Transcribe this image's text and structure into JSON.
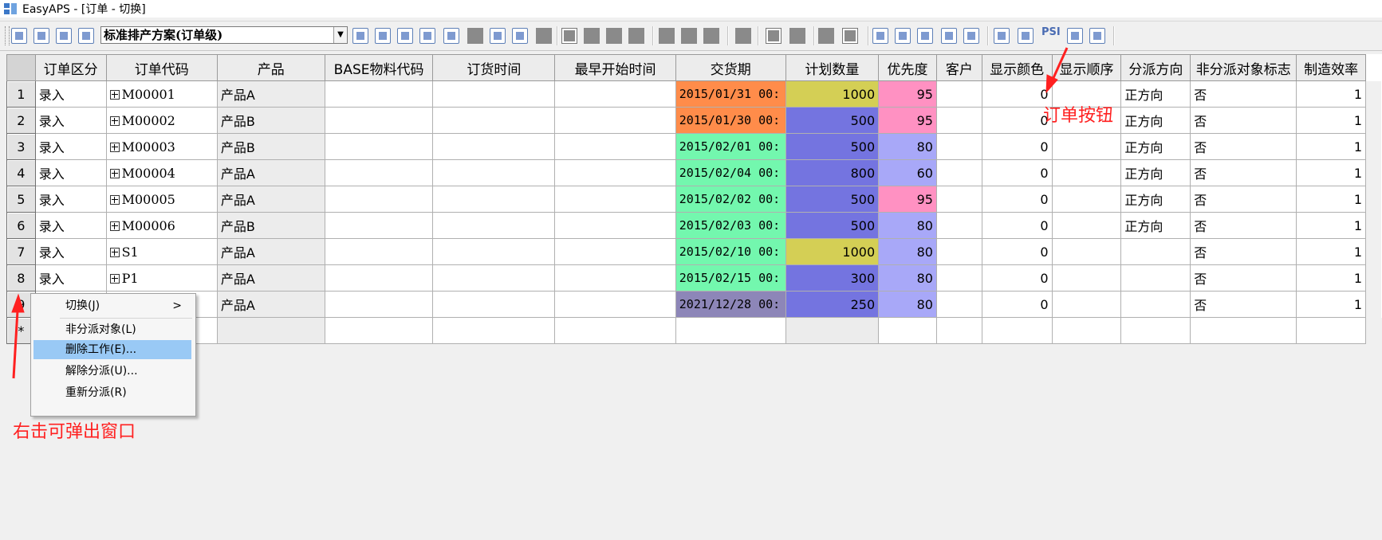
{
  "window": {
    "title": "EasyAPS - [订单 - 切换]"
  },
  "toolbar": {
    "scheme_selected": "标准排产方案(订单级)",
    "psi_label": "PSI"
  },
  "grid": {
    "columns": [
      "订单区分",
      "订单代码",
      "产品",
      "BASE物料代码",
      "订货时间",
      "最早开始时间",
      "交货期",
      "计划数量",
      "优先度",
      "客户",
      "显示颜色",
      "显示顺序",
      "分派方向",
      "非分派对象标志",
      "制造效率"
    ],
    "rows": [
      {
        "n": "1",
        "type": "录入",
        "code": "M00001",
        "product": "产品A",
        "due": "2015/01/31 00:",
        "due_color": "#ff8c4a",
        "qty": "1000",
        "qty_color": "#d4cf55",
        "pri": "95",
        "pri_color": "#ff91c2",
        "color": "0",
        "dir": "正方向",
        "flag": "否",
        "eff": "1"
      },
      {
        "n": "2",
        "type": "录入",
        "code": "M00002",
        "product": "产品B",
        "due": "2015/01/30 00:",
        "due_color": "#ff8c4a",
        "qty": "500",
        "qty_color": "#7474e0",
        "pri": "95",
        "pri_color": "#ff91c2",
        "color": "0",
        "dir": "正方向",
        "flag": "否",
        "eff": "1"
      },
      {
        "n": "3",
        "type": "录入",
        "code": "M00003",
        "product": "产品B",
        "due": "2015/02/01 00:",
        "due_color": "#73f7ae",
        "qty": "500",
        "qty_color": "#7474e0",
        "pri": "80",
        "pri_color": "#a8a8f8",
        "color": "0",
        "dir": "正方向",
        "flag": "否",
        "eff": "1"
      },
      {
        "n": "4",
        "type": "录入",
        "code": "M00004",
        "product": "产品A",
        "due": "2015/02/04 00:",
        "due_color": "#73f7ae",
        "qty": "800",
        "qty_color": "#7474e0",
        "pri": "60",
        "pri_color": "#a8a8f8",
        "color": "0",
        "dir": "正方向",
        "flag": "否",
        "eff": "1"
      },
      {
        "n": "5",
        "type": "录入",
        "code": "M00005",
        "product": "产品A",
        "due": "2015/02/02 00:",
        "due_color": "#73f7ae",
        "qty": "500",
        "qty_color": "#7474e0",
        "pri": "95",
        "pri_color": "#ff91c2",
        "color": "0",
        "dir": "正方向",
        "flag": "否",
        "eff": "1"
      },
      {
        "n": "6",
        "type": "录入",
        "code": "M00006",
        "product": "产品B",
        "due": "2015/02/03 00:",
        "due_color": "#73f7ae",
        "qty": "500",
        "qty_color": "#7474e0",
        "pri": "80",
        "pri_color": "#a8a8f8",
        "color": "0",
        "dir": "正方向",
        "flag": "否",
        "eff": "1"
      },
      {
        "n": "7",
        "type": "录入",
        "code": "S1",
        "product": "产品A",
        "due": "2015/02/10 00:",
        "due_color": "#73f7ae",
        "qty": "1000",
        "qty_color": "#d4cf55",
        "pri": "80",
        "pri_color": "#a8a8f8",
        "color": "0",
        "dir": "",
        "flag": "否",
        "eff": "1"
      },
      {
        "n": "8",
        "type": "录入",
        "code": "P1",
        "product": "产品A",
        "due": "2015/02/15 00:",
        "due_color": "#73f7ae",
        "qty": "300",
        "qty_color": "#7474e0",
        "pri": "80",
        "pri_color": "#a8a8f8",
        "color": "0",
        "dir": "",
        "flag": "否",
        "eff": "1"
      },
      {
        "n": "9",
        "type": "",
        "code": "",
        "product": "产品A",
        "due": "2021/12/28 00:",
        "due_color": "#8d86b8",
        "qty": "250",
        "qty_color": "#7474e0",
        "pri": "80",
        "pri_color": "#a8a8f8",
        "color": "0",
        "dir": "",
        "flag": "否",
        "eff": "1"
      }
    ],
    "new_row_marker": "*"
  },
  "context_menu": {
    "items": [
      "切换(J)",
      "非分派对象(L)",
      "删除工作(E)...",
      "解除分派(U)...",
      "重新分派(R)"
    ],
    "submenu_arrow": ">"
  },
  "annotations": {
    "order_button": "订单按钮",
    "right_click": "右击可弹出窗口"
  }
}
